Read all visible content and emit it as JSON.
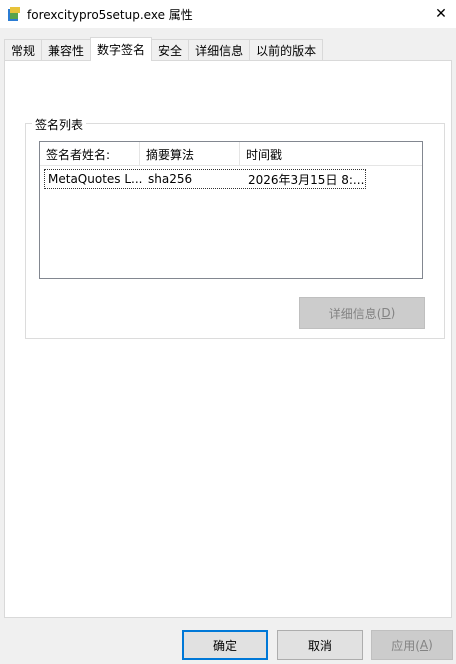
{
  "window": {
    "title": "forexcitypro5setup.exe 属性",
    "close_glyph": "✕",
    "icon": "setup-installer-icon"
  },
  "tabs": [
    {
      "label": "常规",
      "active": false
    },
    {
      "label": "兼容性",
      "active": false
    },
    {
      "label": "数字签名",
      "active": true
    },
    {
      "label": "安全",
      "active": false
    },
    {
      "label": "详细信息",
      "active": false
    },
    {
      "label": "以前的版本",
      "active": false
    }
  ],
  "signature_group": {
    "title": "签名列表",
    "columns": [
      "签名者姓名:",
      "摘要算法",
      "时间戳"
    ],
    "rows": [
      {
        "name": "MetaQuotes L...",
        "algorithm": "sha256",
        "timestamp": "2026年3月15日 8:..."
      }
    ],
    "details_button": {
      "label": "详细信息(",
      "hotkey": "D",
      "suffix": ")",
      "enabled": false
    }
  },
  "footer": {
    "ok_label": "确定",
    "cancel_label": "取消",
    "apply_label": "应用(",
    "apply_hotkey": "A",
    "apply_suffix": ")",
    "apply_enabled": false
  },
  "colors": {
    "accent": "#0078d7",
    "dialog_bg": "#f0f0f0",
    "disabled_text": "#838383"
  }
}
